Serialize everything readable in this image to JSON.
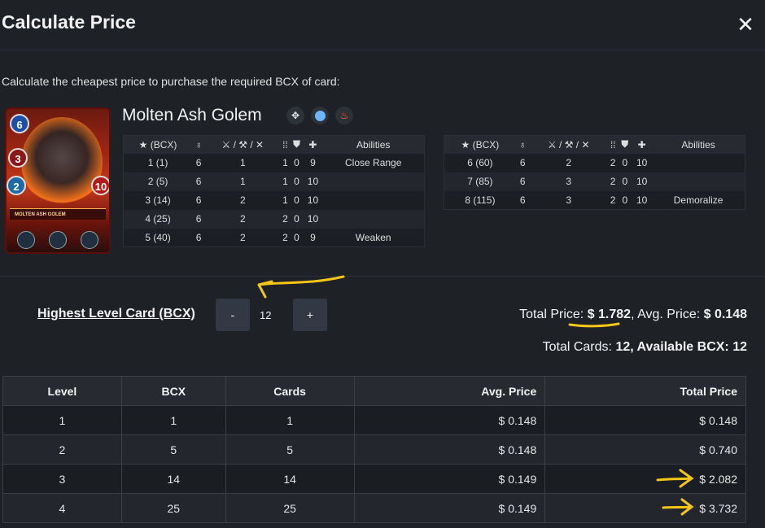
{
  "dialog": {
    "title": "Calculate Price",
    "close_glyph": "✕"
  },
  "intro": "Calculate the cheapest price to purchase the required BCX of card:",
  "card": {
    "name": "Molten Ash Golem",
    "mana": "6",
    "melee": "3",
    "speed": "2",
    "health": "10",
    "plate": "MOLTEN ASH GOLEM",
    "icons": [
      "diamond-arrows-icon",
      "water-dot-icon",
      "fire-icon"
    ]
  },
  "stats_header": {
    "bcx": "(BCX)",
    "abilities": "Abilities"
  },
  "stats_left": [
    {
      "level": "1 (1)",
      "mana": "6",
      "attack": "1",
      "speed": "1",
      "armor": "0",
      "health": "9",
      "ability": "Close Range"
    },
    {
      "level": "2 (5)",
      "mana": "6",
      "attack": "1",
      "speed": "1",
      "armor": "0",
      "health": "10",
      "ability": ""
    },
    {
      "level": "3 (14)",
      "mana": "6",
      "attack": "2",
      "speed": "1",
      "armor": "0",
      "health": "10",
      "ability": ""
    },
    {
      "level": "4 (25)",
      "mana": "6",
      "attack": "2",
      "speed": "2",
      "armor": "0",
      "health": "10",
      "ability": ""
    },
    {
      "level": "5 (40)",
      "mana": "6",
      "attack": "2",
      "speed": "2",
      "armor": "0",
      "health": "9",
      "ability": "Weaken"
    }
  ],
  "stats_right": [
    {
      "level": "6 (60)",
      "mana": "6",
      "attack": "2",
      "speed": "2",
      "armor": "0",
      "health": "10",
      "ability": ""
    },
    {
      "level": "7 (85)",
      "mana": "6",
      "attack": "3",
      "speed": "2",
      "armor": "0",
      "health": "10",
      "ability": ""
    },
    {
      "level": "8 (115)",
      "mana": "6",
      "attack": "3",
      "speed": "2",
      "armor": "0",
      "health": "10",
      "ability": "Demoralize"
    }
  ],
  "highest_level": {
    "label": "Highest Level Card (BCX)",
    "minus": "-",
    "plus": "+",
    "value": "12"
  },
  "summary": {
    "total_price_label": "Total Price:",
    "total_price": "$ 1.782",
    "avg_price_label": ", Avg. Price:",
    "avg_price": "$ 0.148",
    "total_cards_label": "Total Cards:",
    "total_cards": "12",
    "available_bcx_label": ", Available BCX:",
    "available_bcx": "12"
  },
  "table": {
    "headers": [
      "Level",
      "BCX",
      "Cards",
      "Avg. Price",
      "Total Price"
    ],
    "rows": [
      {
        "level": "1",
        "bcx": "1",
        "cards": "1",
        "avg": "$ 0.148",
        "total": "$ 0.148"
      },
      {
        "level": "2",
        "bcx": "5",
        "cards": "5",
        "avg": "$ 0.148",
        "total": "$ 0.740"
      },
      {
        "level": "3",
        "bcx": "14",
        "cards": "14",
        "avg": "$ 0.149",
        "total": "$ 2.082"
      },
      {
        "level": "4",
        "bcx": "25",
        "cards": "25",
        "avg": "$ 0.149",
        "total": "$ 3.732"
      }
    ]
  },
  "colors": {
    "accent_link": "#3d8ef0",
    "annotation": "#f5c518",
    "background": "#1e2126"
  }
}
